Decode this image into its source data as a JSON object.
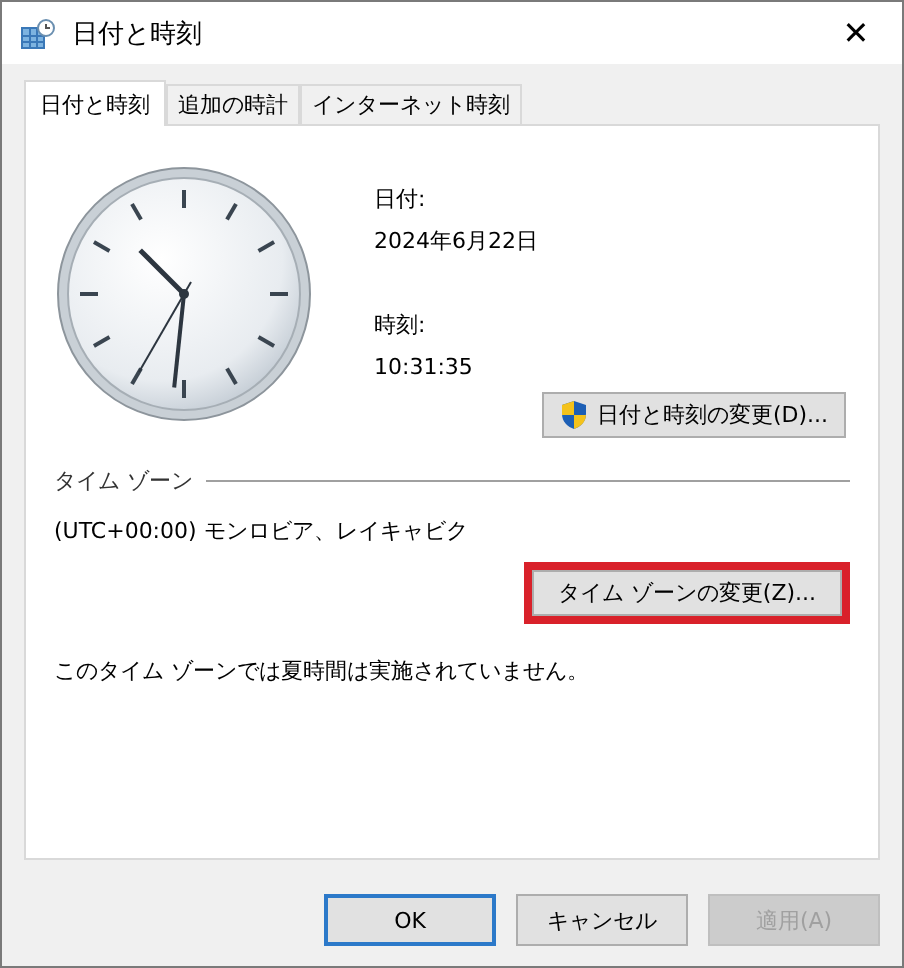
{
  "window": {
    "title": "日付と時刻",
    "close": "✕"
  },
  "tabs": [
    {
      "label": "日付と時刻",
      "selected": true
    },
    {
      "label": "追加の時計",
      "selected": false
    },
    {
      "label": "インターネット時刻",
      "selected": false
    }
  ],
  "date": {
    "label": "日付:",
    "value": "2024年6月22日"
  },
  "time": {
    "label": "時刻:",
    "value": "10:31:35"
  },
  "change_datetime_button": {
    "label": "日付と時刻の変更(D)...",
    "shield": true
  },
  "timezone": {
    "heading": "タイム ゾーン",
    "value": "(UTC+00:00) モンロビア、レイキャビク",
    "button": {
      "label": "タイム ゾーンの変更(Z)...",
      "highlighted": true
    },
    "dst_note": "このタイム ゾーンでは夏時間は実施されていません。"
  },
  "buttons": [
    {
      "label": "OK",
      "default": true,
      "disabled": false
    },
    {
      "label": "キャンセル",
      "default": false,
      "disabled": false
    },
    {
      "label": "適用(A)",
      "default": false,
      "disabled": true
    }
  ]
}
